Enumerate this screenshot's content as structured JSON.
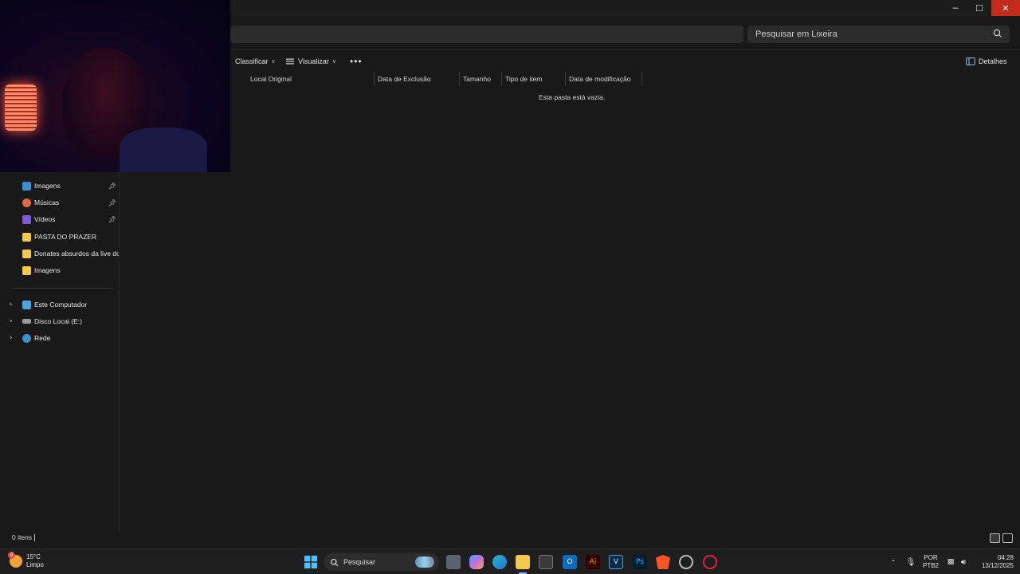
{
  "window": {
    "minimize_glyph": "─",
    "maximize_glyph": "☐",
    "close_glyph": "✕"
  },
  "search": {
    "placeholder": "Pesquisar em Lixeira",
    "icon": "search-icon"
  },
  "toolbar": {
    "sort_label": "Classificar",
    "view_label": "Visualizar",
    "more_label": "•••",
    "details_label": "Detalhes"
  },
  "columns": [
    "Local Original",
    "Data de Exclusão",
    "Tamanho",
    "Tipo de item",
    "Data de modificação"
  ],
  "empty_message": "Esta pasta está vazia.",
  "sidebar": {
    "pinned": [
      {
        "label": "Imagens",
        "icon": "pictures-icon",
        "color": "#3a8fd8"
      },
      {
        "label": "Músicas",
        "icon": "music-icon",
        "color": "#e06a4a"
      },
      {
        "label": "Vídeos",
        "icon": "videos-icon",
        "color": "#7b5bd6"
      }
    ],
    "folders": [
      {
        "label": "PASTA DO PRAZER",
        "icon": "folder-icon"
      },
      {
        "label": "Donates absurdos da live do L",
        "icon": "folder-icon"
      },
      {
        "label": "Imagens",
        "icon": "folder-icon"
      }
    ],
    "locations": [
      {
        "label": "Este Computador",
        "icon": "computer-icon"
      },
      {
        "label": "Disco Local (E:)",
        "icon": "drive-icon"
      },
      {
        "label": "Rede",
        "icon": "network-icon"
      }
    ],
    "folder_color": "#f2c84b"
  },
  "status": {
    "item_count": "0 itens"
  },
  "taskbar": {
    "weather_temp": "15°C",
    "weather_desc": "Limpo",
    "weather_badge": "6",
    "search_placeholder": "Pesquisar",
    "language": "POR",
    "layout": "PTB2",
    "time": "04:28",
    "date": "13/12/2025"
  }
}
